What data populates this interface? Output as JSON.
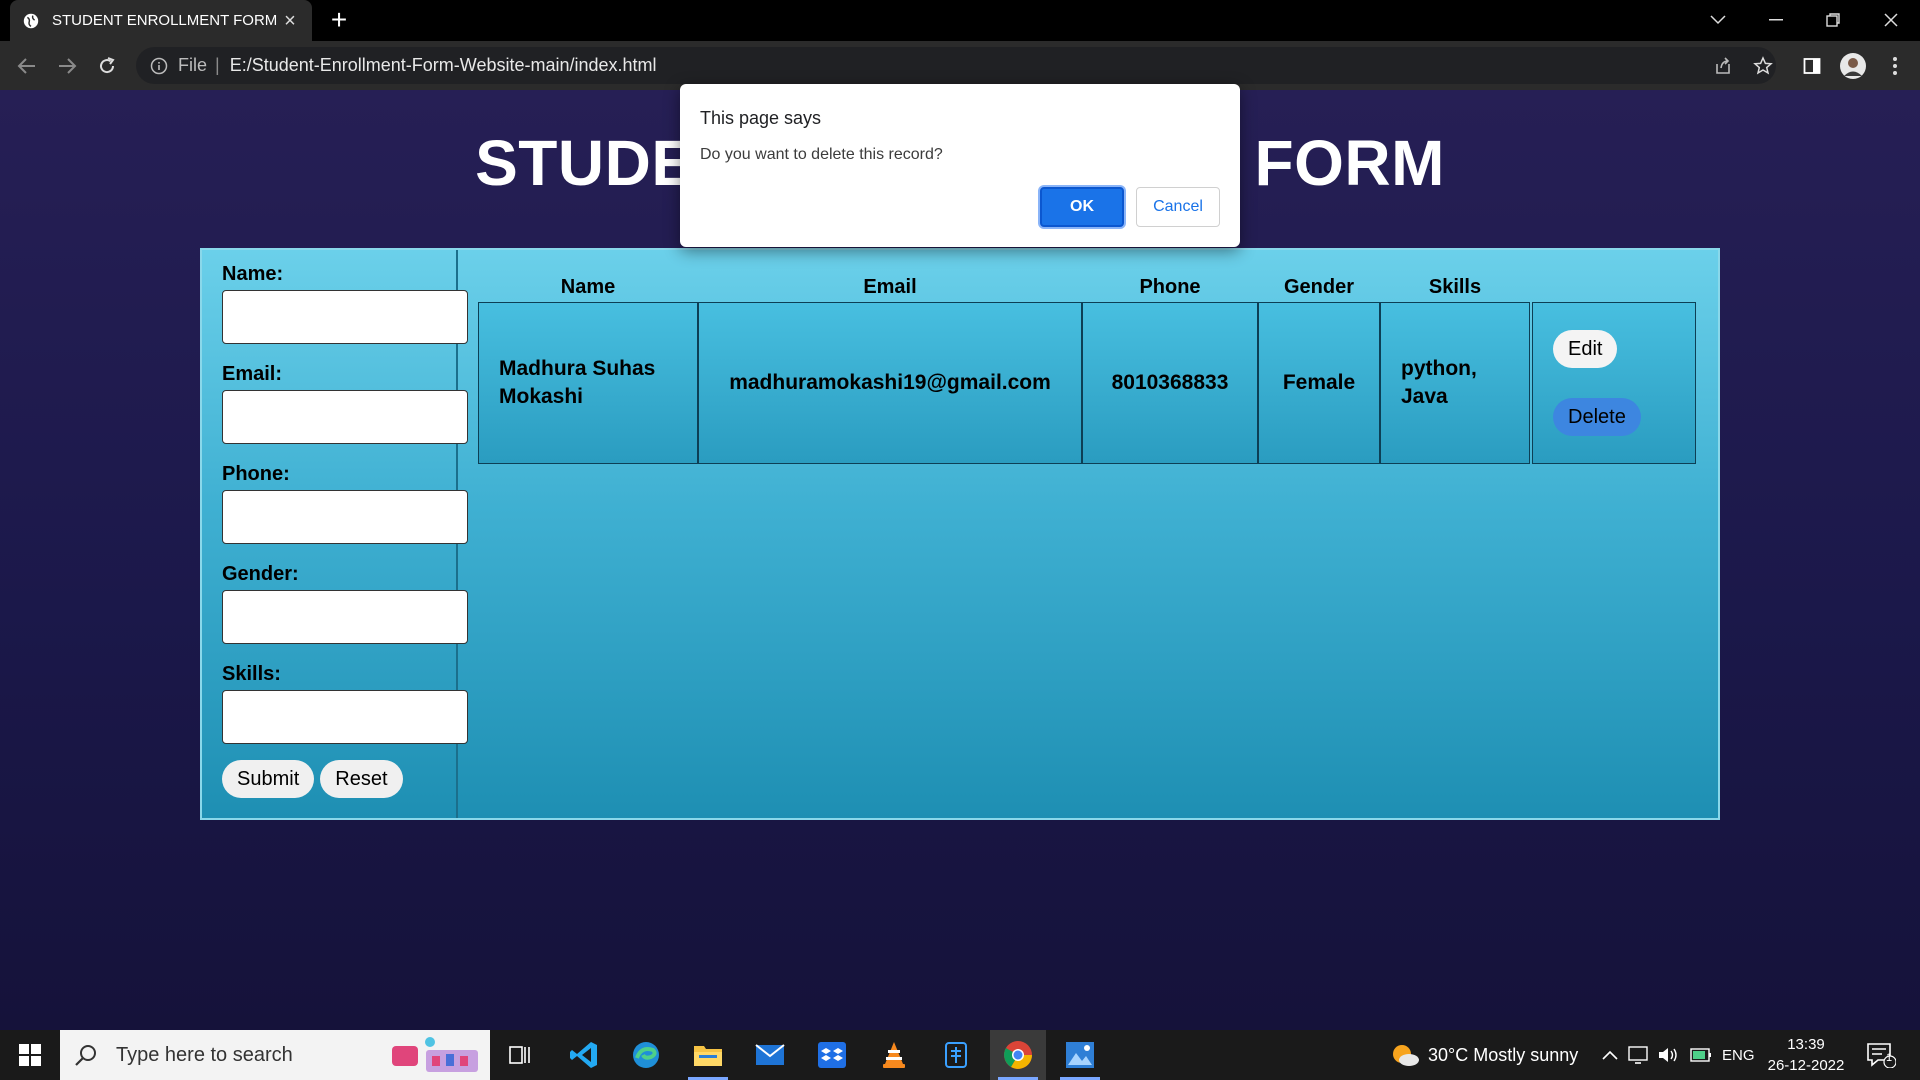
{
  "browser": {
    "tab_title": "STUDENT ENROLLMENT FORM",
    "address_scheme": "File",
    "address_path": "E:/Student-Enrollment-Form-Website-main/index.html"
  },
  "page": {
    "title_left": "STUDE",
    "title_right": "FORM"
  },
  "form": {
    "labels": {
      "name": "Name:",
      "email": "Email:",
      "phone": "Phone:",
      "gender": "Gender:",
      "skills": "Skills:"
    },
    "submit_label": "Submit",
    "reset_label": "Reset"
  },
  "table": {
    "headers": [
      "Name",
      "Email",
      "Phone",
      "Gender",
      "Skills"
    ],
    "rows": [
      {
        "name": "Madhura Suhas Mokashi",
        "email": "madhuramokashi19@gmail.com",
        "phone": "8010368833",
        "gender": "Female",
        "skills": "python, Java",
        "edit_label": "Edit",
        "delete_label": "Delete"
      }
    ]
  },
  "dialog": {
    "title": "This page says",
    "message": "Do you want to delete this record?",
    "ok_label": "OK",
    "cancel_label": "Cancel"
  },
  "taskbar": {
    "search_placeholder": "Type here to search",
    "weather": "30°C  Mostly sunny",
    "language": "ENG",
    "time": "13:39",
    "date": "26-12-2022",
    "notification_count": "1"
  },
  "colors": {
    "accent_blue": "#1a73e8",
    "panel_cyan": "#4fc3e3",
    "page_bg": "#1c1a45"
  }
}
